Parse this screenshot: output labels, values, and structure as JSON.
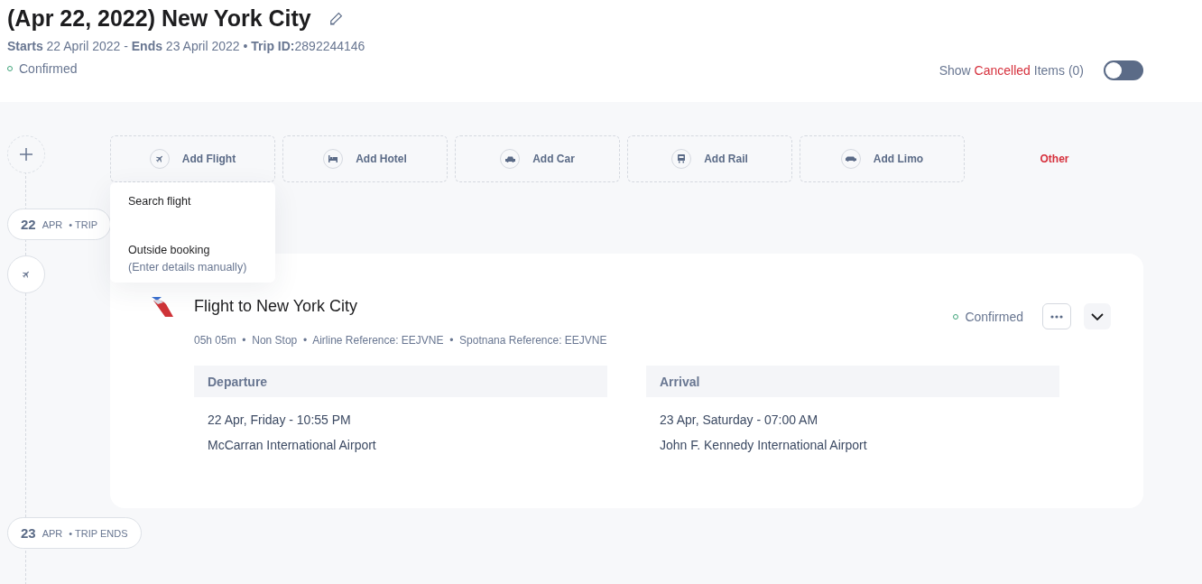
{
  "trip": {
    "title": "(Apr 22, 2022) New York City",
    "subtitle": "**Starts** 22 April 2022 - **Ends** 23 April 2022 • **Trip ID:**2892244146",
    "status": "Confirmed"
  },
  "cancelled_toggle": {
    "before": "Show",
    "highlight": "Cancelled",
    "after": "Items (0)",
    "on": false
  },
  "add_actions": [
    {
      "kind": "flight",
      "label": "Add Flight"
    },
    {
      "kind": "hotel",
      "label": "Add Hotel"
    },
    {
      "kind": "car",
      "label": "Add Car"
    },
    {
      "kind": "rail",
      "label": "Add Rail"
    },
    {
      "kind": "limo",
      "label": "Add Limo"
    },
    {
      "kind": "other",
      "label": "Other"
    }
  ],
  "flight_menu": {
    "expanded": true,
    "items": [
      {
        "label": "Search flight"
      },
      {
        "label": "Outside booking",
        "hint": "(Enter details manually)"
      }
    ]
  },
  "timeline": {
    "start": {
      "day": "22",
      "month": "APR",
      "label": "• TRIP"
    },
    "end": {
      "day": "23",
      "month": "APR",
      "label": "• TRIP ENDS"
    }
  },
  "flight": {
    "title": "Flight to New York City",
    "meta": "05h 05m  •  Non Stop  •  Airline Reference: EEJVNE  •  Spotnana Reference: EEJVNE",
    "status": "Confirmed",
    "expanded": false,
    "legs": [
      {
        "heading": "Departure",
        "datetime": "22 Apr, Friday - 10:55 PM",
        "airport": "McCarran International Airport"
      },
      {
        "heading": "Arrival",
        "datetime": "23 Apr, Saturday - 07:00 AM",
        "airport": "John F. Kennedy International Airport"
      }
    ]
  }
}
